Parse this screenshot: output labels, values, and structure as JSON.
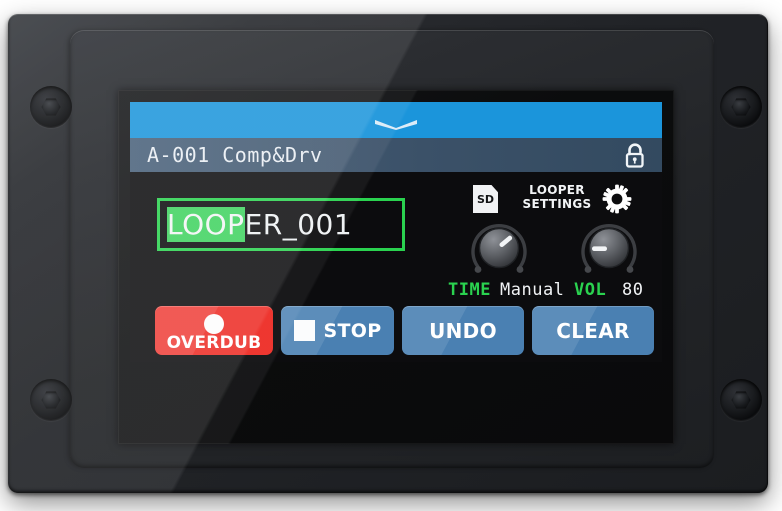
{
  "device": {
    "name": "multi-effects-pedal-lcd-unit",
    "screws": [
      "screw-top-left",
      "screw-top-right",
      "screw-bottom-left",
      "screw-bottom-right"
    ]
  },
  "screen": {
    "topbar": {
      "handle_icon": "chevron-down-icon",
      "color": "#1b95db"
    },
    "titlebar": {
      "preset": "A-001 Comp&Drv",
      "lock_icon": "lock-open-icon",
      "color": "#3b5168"
    },
    "main": {
      "name_field": {
        "value": "LOOPER_001",
        "selected_text": "LOOP",
        "remaining_text": "ER_001",
        "border_color": "#2ad24f",
        "selection_color": "#3fd35f"
      },
      "sd_icon_label": "SD",
      "settings": {
        "label_line1": "LOOPER",
        "label_line2": "SETTINGS",
        "gear_icon": "gear-icon"
      },
      "knobs": [
        {
          "id": "time",
          "label": "TIME",
          "value": "Manual",
          "label_color": "#2ad24f",
          "pointer_angle": -130
        },
        {
          "id": "vol",
          "label": "VOL",
          "value": "80",
          "label_color": "#2ad24f",
          "pointer_angle": 90
        }
      ],
      "buttons": [
        {
          "id": "overdub",
          "label": "OVERDUB",
          "icon": "record-circle-icon",
          "color": "#ed2b24"
        },
        {
          "id": "stop",
          "label": "STOP",
          "icon": "stop-square-icon",
          "color": "#4a80b2"
        },
        {
          "id": "undo",
          "label": "UNDO",
          "icon": "",
          "color": "#4a80b2"
        },
        {
          "id": "clear",
          "label": "CLEAR",
          "icon": "",
          "color": "#4a80b2"
        }
      ]
    }
  }
}
